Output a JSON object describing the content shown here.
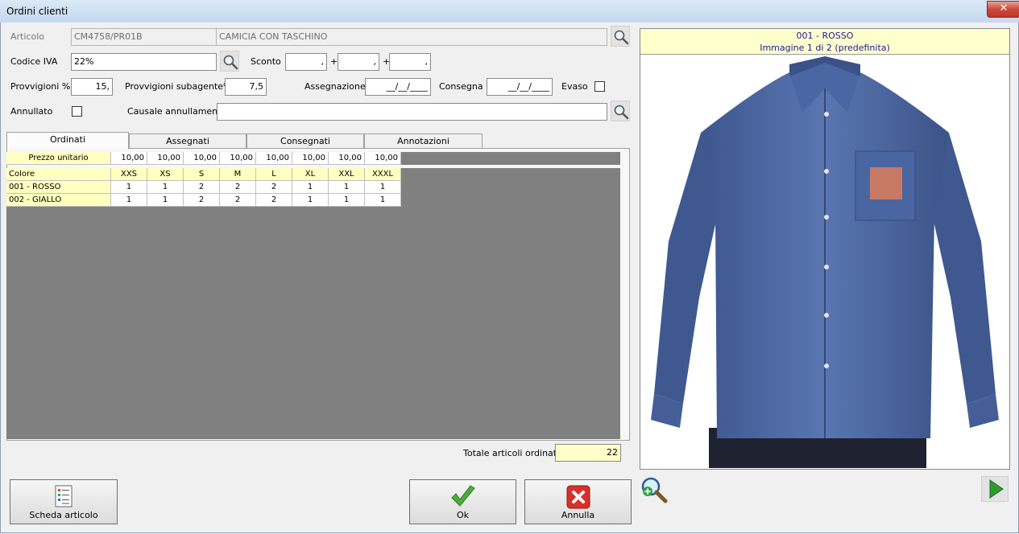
{
  "window": {
    "title": "Ordini clienti",
    "close_glyph": "✕"
  },
  "form": {
    "articolo_label": "Articolo",
    "articolo_code": "CM4758/PR01B",
    "articolo_desc": "CAMICIA CON TASCHINO",
    "iva_label": "Codice IVA",
    "iva_value": "22%",
    "sconto_label": "Sconto",
    "sconto_values": [
      ",",
      ",",
      ","
    ],
    "plus": "+",
    "provvigioni_label": "Provvigioni %",
    "provvigioni_value": "15,",
    "subagente_label": "Provvigioni subagente%",
    "subagente_value": "7,5",
    "assegnazione_label": "Assegnazione",
    "assegnazione_value": "__/__/____",
    "consegna_label": "Consegna",
    "consegna_value": "__/__/____",
    "evaso_label": "Evaso",
    "annullato_label": "Annullato",
    "causale_label": "Causale annullamento",
    "causale_value": ""
  },
  "tabs": [
    {
      "label": "Ordinati",
      "active": true
    },
    {
      "label": "Assegnati",
      "active": false
    },
    {
      "label": "Consegnati",
      "active": false
    },
    {
      "label": "Annotazioni",
      "active": false
    }
  ],
  "price_row": {
    "label": "Prezzo unitario",
    "values": [
      "10,00",
      "10,00",
      "10,00",
      "10,00",
      "10,00",
      "10,00",
      "10,00",
      "10,00"
    ]
  },
  "size_grid": {
    "color_header": "Colore",
    "sizes": [
      "XXS",
      "XS",
      "S",
      "M",
      "L",
      "XL",
      "XXL",
      "XXXL"
    ],
    "rows": [
      {
        "color": "001 - ROSSO",
        "qty": [
          "1",
          "1",
          "2",
          "2",
          "2",
          "1",
          "1",
          "1"
        ]
      },
      {
        "color": "002 - GIALLO",
        "qty": [
          "1",
          "1",
          "2",
          "2",
          "2",
          "1",
          "1",
          "1"
        ]
      }
    ]
  },
  "totals": {
    "label": "Totale articoli ordinati",
    "value": "22"
  },
  "image_panel": {
    "caption_line1": "001 - ROSSO",
    "caption_line2": "Immagine 1 di 2 (predefinita)",
    "shirt_color": "#4f6aa3",
    "patch_color": "#c87a64"
  },
  "buttons": {
    "scheda": "Scheda articolo",
    "ok": "Ok",
    "annulla": "Annulla"
  },
  "icons": {
    "search": "search-icon",
    "zoom": "zoom-in-icon",
    "next": "next-arrow-icon",
    "ok": "checkmark-icon",
    "cancel": "cancel-x-icon",
    "scheda": "document-list-icon"
  }
}
